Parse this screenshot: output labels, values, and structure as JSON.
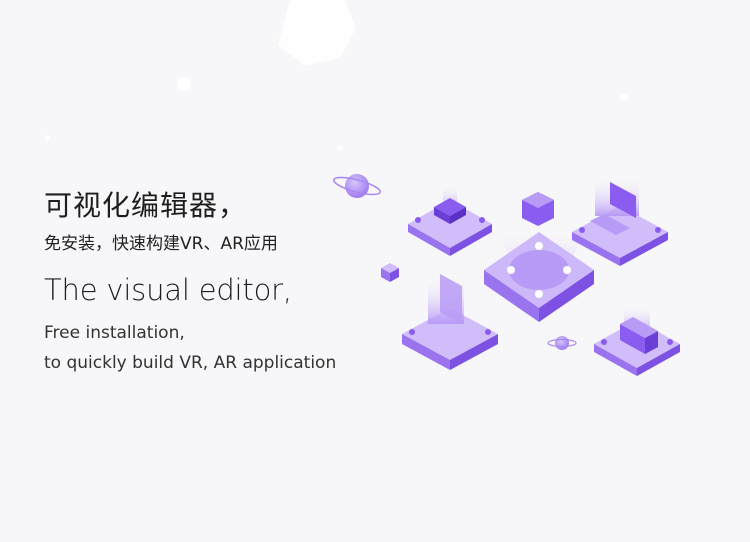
{
  "hero": {
    "title_cn": "可视化编辑器，",
    "subtitle_cn": "免安装，快速构建VR、AR应用",
    "title_en": "The visual editor,",
    "subtitle_en_line1": "Free installation,",
    "subtitle_en_line2": "to quickly build VR, AR application"
  },
  "colors": {
    "background": "#f7f6f8",
    "accent": "#8a5cf0",
    "accent_light": "#c9b3f7",
    "accent_dark": "#6a3fd6"
  },
  "illustration": {
    "icons": [
      "central-platform-icon",
      "building-platform-icon",
      "laptop-platform-icon",
      "panel-platform-icon",
      "factory-platform-icon",
      "planet-icon",
      "cube-icon",
      "hexagon-icon"
    ]
  }
}
